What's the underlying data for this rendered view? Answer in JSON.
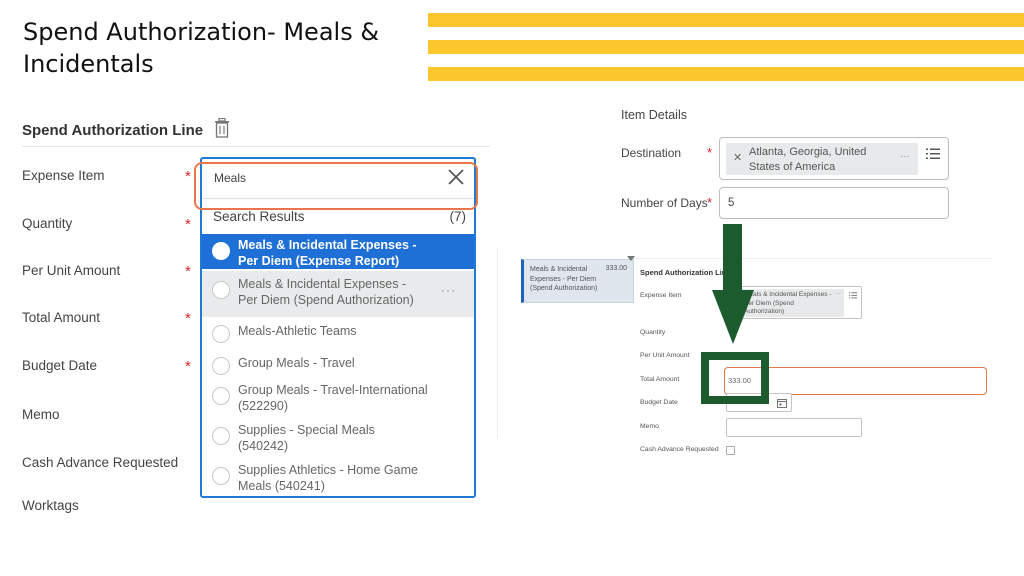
{
  "slide": {
    "title": "Spend Authorization- Meals & Incidentals",
    "accent_color": "#fcc62d",
    "annotation_color": "#1c5b2e",
    "highlight_color": "#e8764b"
  },
  "left_form": {
    "section_title": "Spend Authorization Line",
    "delete_icon": "trash-icon",
    "fields": [
      {
        "label": "Expense Item",
        "required": true
      },
      {
        "label": "Quantity",
        "required": true
      },
      {
        "label": "Per Unit Amount",
        "required": true
      },
      {
        "label": "Total Amount",
        "required": true
      },
      {
        "label": "Budget Date",
        "required": true
      },
      {
        "label": "Memo",
        "required": false
      },
      {
        "label": "Cash Advance Requested",
        "required": false
      },
      {
        "label": "Worktags",
        "required": false
      }
    ],
    "required_marker": "*",
    "dropdown": {
      "search_value": "Meals",
      "clear_icon": "close-icon",
      "results_header": "Search Results",
      "results_count": "(7)",
      "more_glyph": "···",
      "results": [
        {
          "label": "Meals & Incidental Expenses - Per Diem (Expense Report)",
          "state": "selected"
        },
        {
          "label": "Meals & Incidental Expenses - Per Diem (Spend Authorization)",
          "state": "hovered"
        },
        {
          "label": "Meals-Athletic Teams",
          "state": "normal"
        },
        {
          "label": "Group Meals - Travel",
          "state": "normal"
        },
        {
          "label": "Group Meals - Travel-International (522290)",
          "state": "normal"
        },
        {
          "label": "Supplies - Special Meals (540242)",
          "state": "normal"
        },
        {
          "label": "Supplies Athletics - Home Game Meals (540241)",
          "state": "normal"
        }
      ]
    }
  },
  "item_details": {
    "title": "Item Details",
    "destination_label": "Destination",
    "destination_value": "Atlanta, Georgia, United States of America",
    "destination_more": "···",
    "days_label": "Number of Days",
    "days_value": "5",
    "required_marker": "*"
  },
  "result_form": {
    "summary_card": {
      "text": "Meals & Incidental Expenses - Per Diem (Spend Authorization)",
      "amount": "333.00"
    },
    "section_title": "Spend Authorization Line",
    "labels": {
      "expense_item": "Expense Item",
      "quantity": "Quantity",
      "per_unit_amount": "Per Unit Amount",
      "total_amount": "Total Amount",
      "budget_date": "Budget Date",
      "memo": "Memo",
      "cash_advance": "Cash Advance Requested"
    },
    "expense_item_value": "Meals & Incidental Expenses - Per Diem (Spend Authorization)",
    "expense_more": "···",
    "total_amount_value": "333.00",
    "required_marker": "*"
  }
}
